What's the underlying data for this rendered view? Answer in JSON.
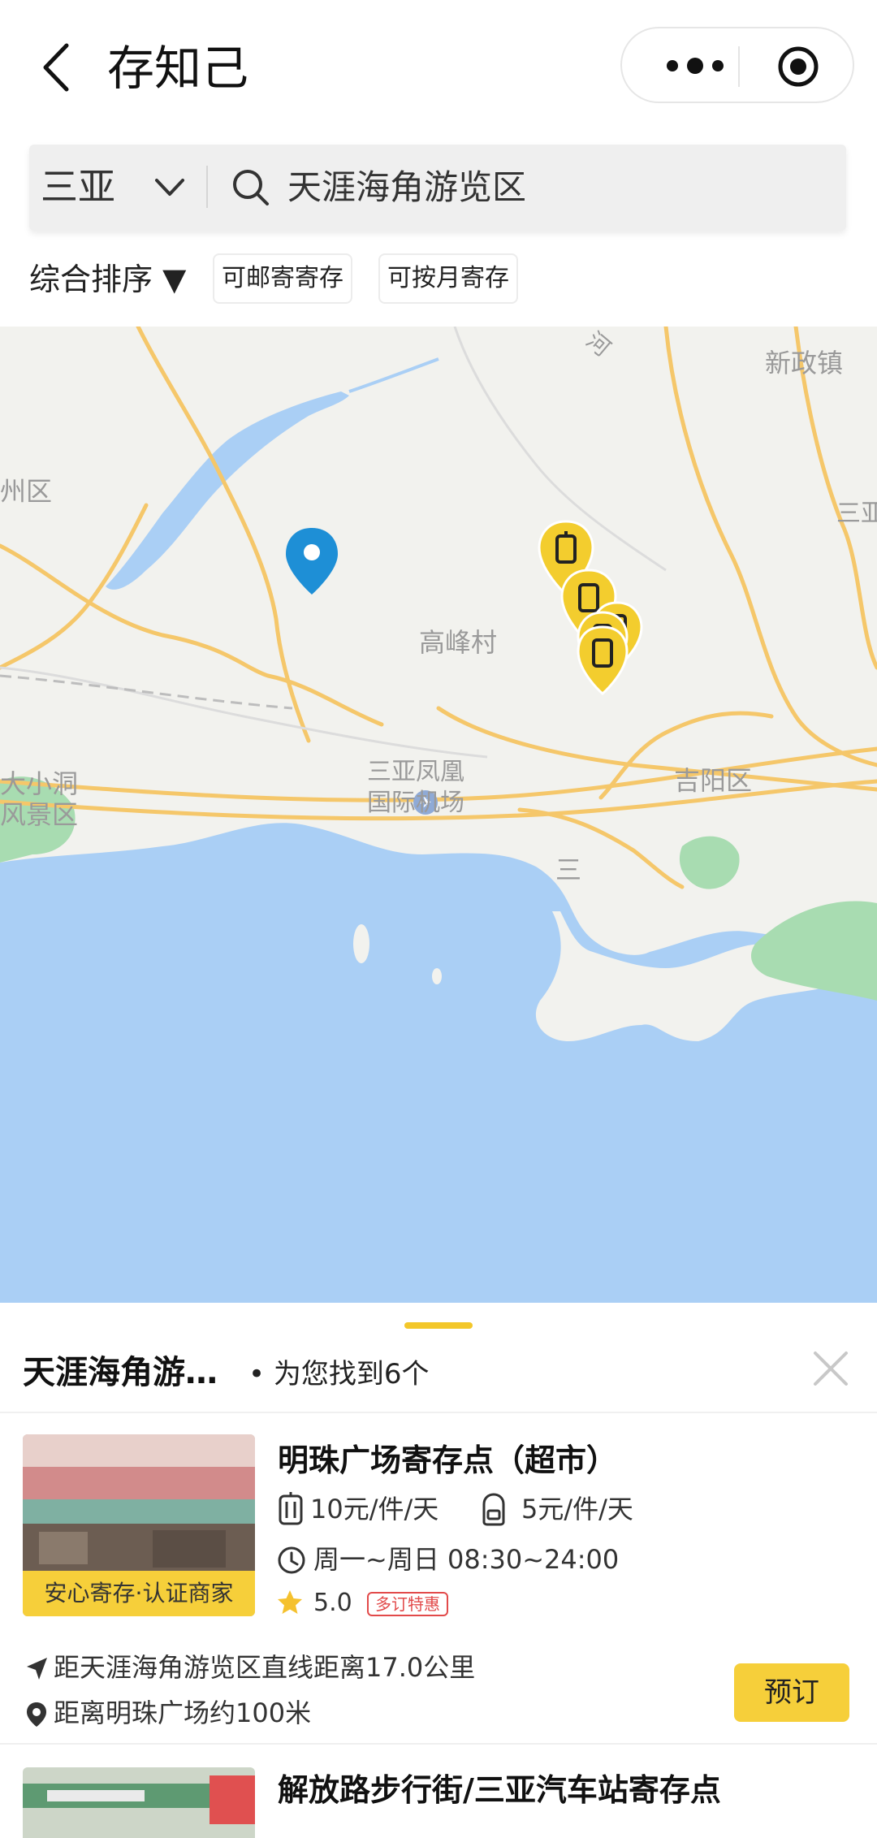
{
  "header": {
    "title": "存知己",
    "icons": {
      "back": "back-chevron-icon",
      "more": "more-dots-icon",
      "close": "target-circle-icon"
    }
  },
  "search": {
    "city": "三亚",
    "query": "天涯海角游览区",
    "icons": {
      "chevron": "chevron-down-icon",
      "search": "search-icon"
    }
  },
  "filters": {
    "sort_label": "综合排序 ▼",
    "chips": [
      "可邮寄寄存",
      "可按月寄存"
    ]
  },
  "map": {
    "labels": [
      "新政镇",
      "三亚",
      "高峰村",
      "州区",
      "三亚凤凰",
      "国际机场",
      "吉阳区",
      "大小洞",
      "风景区",
      "河",
      "三"
    ],
    "pins": {
      "location_pin": "location-pin-icon",
      "luggage_pin": "luggage-pin-icon",
      "luggage_pin_count": 5
    },
    "colors": {
      "sea": "#aacff5",
      "land": "#f2f2ee",
      "road": "#f5c76a",
      "park": "#a8dcb1",
      "pin_yellow": "#f3cd2e",
      "pin_blue": "#1e8fd6"
    }
  },
  "sheet": {
    "title": "天涯海角游…",
    "count_text": "• 为您找到6个",
    "close_icon": "close-x-icon",
    "stores": [
      {
        "name": "明珠广场寄存点（超市）",
        "badge": "安心寄存·认证商家",
        "price_luggage": "10元/件/天",
        "price_bag": "5元/件/天",
        "hours": "周一~周日 08:30~24:00",
        "rating": "5.0",
        "promo": "多订特惠",
        "distance_line": "距天涯海角游览区直线距离17.0公里",
        "landmark_line": "距离明珠广场约100米",
        "book_label": "预订"
      },
      {
        "name": "解放路步行街/三亚汽车站寄存点"
      }
    ]
  }
}
